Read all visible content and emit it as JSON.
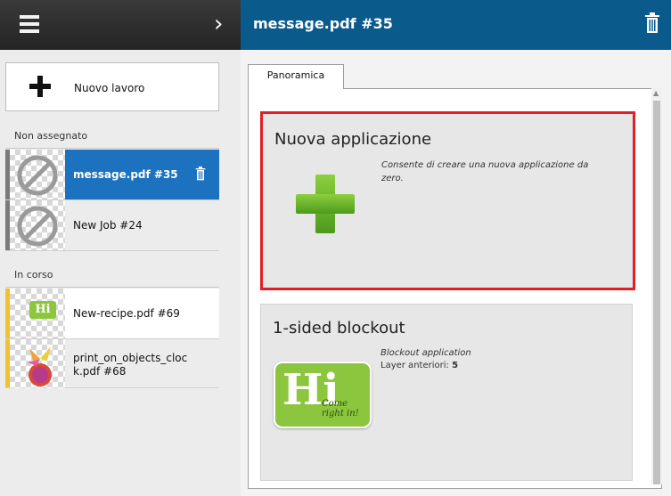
{
  "header": {
    "left_title": "",
    "title": "message.pdf #35"
  },
  "sidebar": {
    "new_job_label": "Nuovo lavoro",
    "sections": [
      {
        "title": "Non assegnato",
        "jobs": [
          {
            "name": "message.pdf #35",
            "selected": true
          },
          {
            "name": "New Job #24",
            "selected": false
          }
        ]
      },
      {
        "title": "In corso",
        "jobs": [
          {
            "name": "New-recipe.pdf #69",
            "selected": false
          },
          {
            "name": "print_on_objects_clock.pdf #68",
            "name_line1": "print_on_objects_cloc",
            "name_line2": "k.pdf #68",
            "selected": false
          }
        ]
      }
    ]
  },
  "main": {
    "tabs": [
      {
        "label": "Panoramica",
        "active": true
      }
    ],
    "cards": [
      {
        "title": "Nuova applicazione",
        "description": "Consente di creare una nuova applicazione da zero.",
        "desc_line1": "Consente di creare una nuova applicazione da",
        "desc_line2": "zero.",
        "highlighted": true
      },
      {
        "title": "1-sided blockout",
        "description": "Blockout application",
        "meta_label": "Layer anteriori:",
        "meta_value": "5",
        "highlighted": false
      }
    ]
  },
  "logo": {
    "big": "Hi",
    "tag1": "Come",
    "tag2": "right in!"
  },
  "colors": {
    "topbar_right": "#0a5a8c",
    "selected": "#1d72bf",
    "highlight_border": "#e01f26",
    "stripe_unassigned": "#8a8a8a",
    "stripe_inprogress": "#f2c12e",
    "logo_green": "#8cc63f"
  }
}
